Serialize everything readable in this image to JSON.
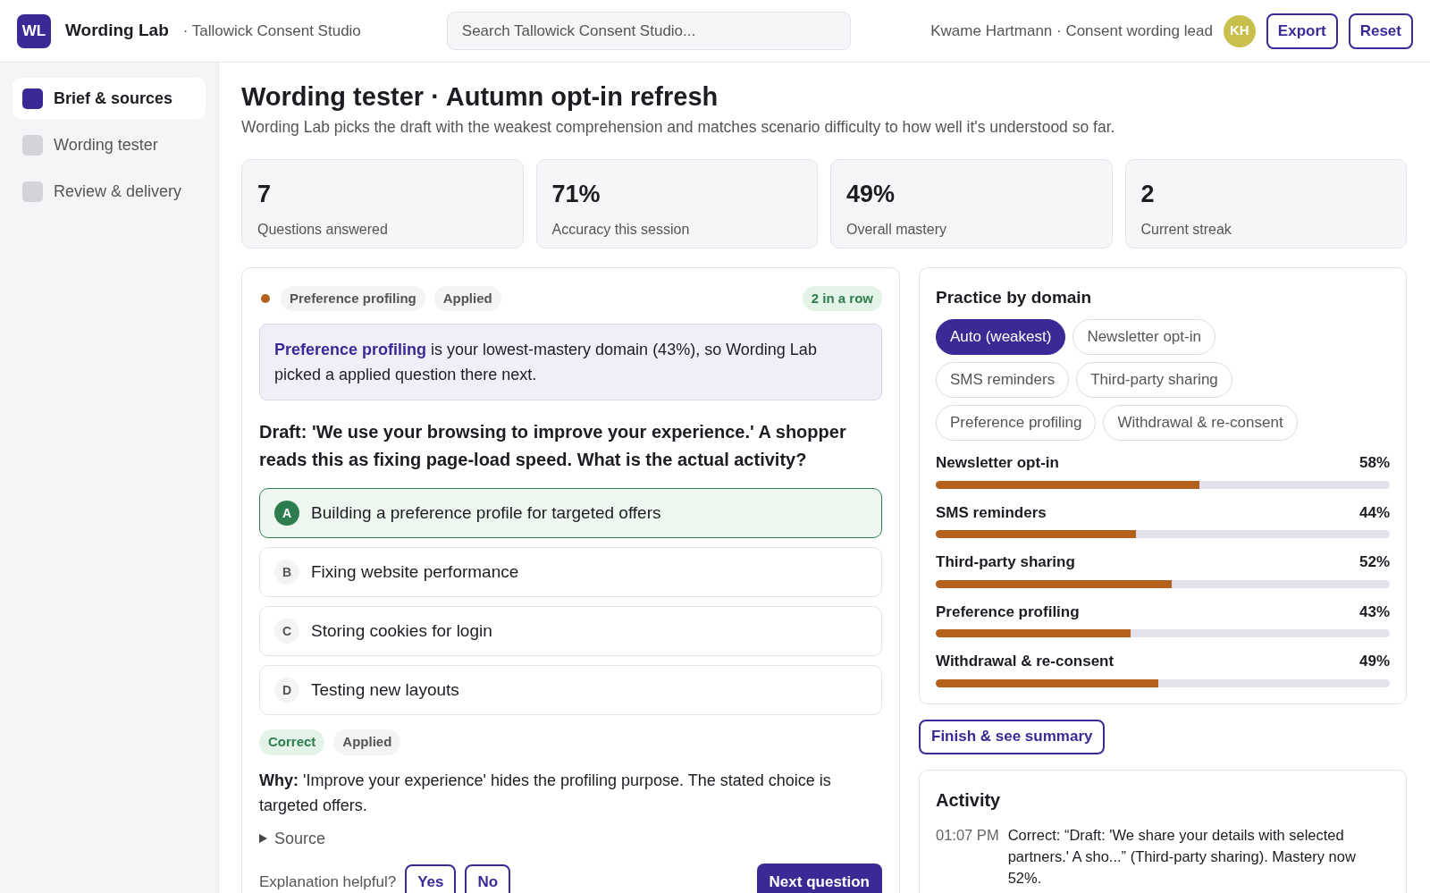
{
  "header": {
    "logo": "WL",
    "app_name": "Wording Lab",
    "workspace": "· Tallowick Consent Studio",
    "search": {
      "placeholder": "Search Tallowick Consent Studio..."
    },
    "user": "Kwame Hartmann · Consent wording lead",
    "avatar": "KH",
    "buttons": [
      "Export",
      "Reset"
    ]
  },
  "sidebar": {
    "items": [
      {
        "label": "Brief & sources",
        "selected": true
      },
      {
        "label": "Wording tester",
        "selected": false
      },
      {
        "label": "Review & delivery",
        "selected": false
      }
    ]
  },
  "page": {
    "title": "Wording tester · Autumn opt-in refresh",
    "subtitle": "Wording Lab picks the draft with the weakest comprehension and matches scenario difficulty to how well it's understood so far."
  },
  "stats": [
    {
      "value": "7",
      "label": "Questions answered"
    },
    {
      "value": "71%",
      "label": "Accuracy this session"
    },
    {
      "value": "49%",
      "label": "Overall mastery"
    },
    {
      "value": "2",
      "label": "Current streak"
    }
  ],
  "question": {
    "color": "#b5611e",
    "tags": [
      "Preference profiling",
      "Applied"
    ],
    "streak": "2 in a row",
    "notice": "**Preference profiling** is your lowest-mastery domain (43%), so Wording Lab picked a applied question there next.",
    "prompt": "Draft: 'We use your browsing to improve your experience.' A shopper reads this as fixing page-load speed. What is the actual activity?",
    "options": [
      {
        "letter": "A",
        "text": "Building a preference profile for targeted offers",
        "selected": true
      },
      {
        "letter": "B",
        "text": "Fixing website performance",
        "selected": false
      },
      {
        "letter": "C",
        "text": "Storing cookies for login",
        "selected": false
      },
      {
        "letter": "D",
        "text": "Testing new layouts",
        "selected": false
      }
    ],
    "result_tags": [
      {
        "label": "Correct",
        "kind": "success"
      },
      {
        "label": "Applied",
        "kind": "neutral"
      }
    ],
    "explanation": "**Why:** 'Improve your experience' hides the profiling purpose. The stated choice is targeted offers.",
    "source": {
      "label": "Source",
      "expanded": false
    },
    "feedback": {
      "label": "Explanation helpful?",
      "buttons": [
        "Yes",
        "No"
      ]
    },
    "next_button": "Next question"
  },
  "practice": {
    "title": "Practice by domain",
    "filters": [
      {
        "label": "Auto (weakest)",
        "selected": true
      },
      {
        "label": "Newsletter opt-in",
        "selected": false
      },
      {
        "label": "SMS reminders",
        "selected": false
      },
      {
        "label": "Third-party sharing",
        "selected": false
      },
      {
        "label": "Preference profiling",
        "selected": false
      },
      {
        "label": "Withdrawal & re-consent",
        "selected": false
      }
    ],
    "domains": [
      {
        "name": "Newsletter opt-in",
        "reading": "58%",
        "level": 0.58
      },
      {
        "name": "SMS reminders",
        "reading": "44%",
        "level": 0.44
      },
      {
        "name": "Third-party sharing",
        "reading": "52%",
        "level": 0.52
      },
      {
        "name": "Preference profiling",
        "reading": "43%",
        "level": 0.43
      },
      {
        "name": "Withdrawal & re-consent",
        "reading": "49%",
        "level": 0.49
      }
    ]
  },
  "finish_button": "Finish & see summary",
  "activity": {
    "title": "Activity",
    "entries": [
      {
        "time": "01:07 PM",
        "text": "Correct: “Draft: 'We share your details with selected partners.' A sho...” (Third-party sharing). Mastery now 52%."
      }
    ]
  }
}
